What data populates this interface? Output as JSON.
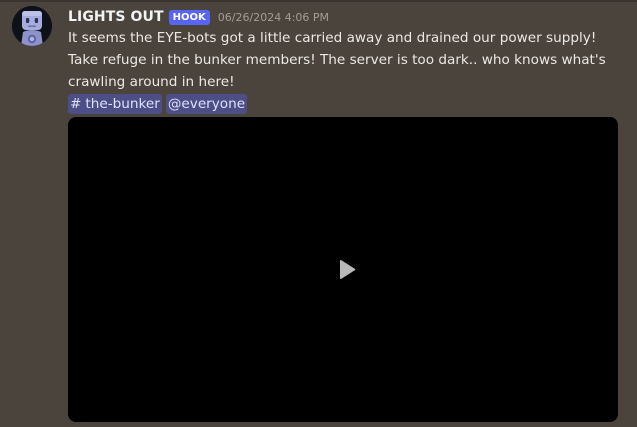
{
  "message": {
    "author": "LIGHTS OUT",
    "tag": "HOOK",
    "timestamp": "06/26/2024 4:06 PM",
    "text": "It seems the EYE-bots got a little carried away and drained our power supply! Take refuge in the bunker members! The server is too dark.. who knows what's crawling around in here!",
    "channel_mention": {
      "symbol": "#",
      "name": "the-bunker"
    },
    "role_mention": "@everyone"
  },
  "icons": {
    "avatar": "robot-avatar-icon",
    "play": "play-icon"
  },
  "colors": {
    "background": "#4a443c",
    "tag": "#5865f2",
    "mention_bg": "#4b4f86",
    "mention_text": "#dee0fc",
    "video": "#000000"
  }
}
